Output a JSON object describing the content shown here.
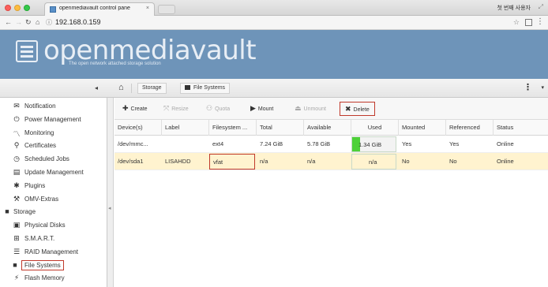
{
  "browser": {
    "tab_title": "openmediavault control pane",
    "tab_close": "×",
    "profile_label": "첫 번째 사용자",
    "url": "192.168.0.159"
  },
  "banner": {
    "logo_text": "openmediavault",
    "tagline": "The open network attached storage solution"
  },
  "toolbar": {
    "breadcrumbs": [
      "Storage",
      "File Systems"
    ],
    "menu_glyph": "⋮"
  },
  "sidebar": {
    "items": [
      {
        "label": "Notification",
        "icon": "mail-icon",
        "glyph": "✉"
      },
      {
        "label": "Power Management",
        "icon": "power-icon",
        "glyph": "⏻"
      },
      {
        "label": "Monitoring",
        "icon": "chart-icon",
        "glyph": "〽"
      },
      {
        "label": "Certificates",
        "icon": "certificate-icon",
        "glyph": "⚲"
      },
      {
        "label": "Scheduled Jobs",
        "icon": "clock-icon",
        "glyph": "◷"
      },
      {
        "label": "Update Management",
        "icon": "trash-icon",
        "glyph": "▤"
      },
      {
        "label": "Plugins",
        "icon": "puzzle-icon",
        "glyph": "✱"
      },
      {
        "label": "OMV-Extras",
        "icon": "wrench-icon",
        "glyph": "⚒"
      },
      {
        "label": "Storage",
        "icon": "storage-icon",
        "glyph": "■",
        "group": true
      },
      {
        "label": "Physical Disks",
        "icon": "disk-icon",
        "glyph": "▣"
      },
      {
        "label": "S.M.A.R.T.",
        "icon": "smart-icon",
        "glyph": "⊞"
      },
      {
        "label": "RAID Management",
        "icon": "raid-icon",
        "glyph": "☰"
      },
      {
        "label": "File Systems",
        "icon": "folder-icon",
        "glyph": "■",
        "selected": true
      },
      {
        "label": "Flash Memory",
        "icon": "flash-icon",
        "glyph": "⚡"
      }
    ]
  },
  "actions": {
    "create": "Create",
    "resize": "Resize",
    "quota": "Quota",
    "mount": "Mount",
    "unmount": "Unmount",
    "delete": "Delete"
  },
  "grid": {
    "columns": [
      "Device(s)",
      "Label",
      "Filesystem ...",
      "Total",
      "Available",
      "Used",
      "Mounted",
      "Referenced",
      "Status"
    ],
    "rows": [
      {
        "device": "/dev/mmc...",
        "label": "",
        "fs": "ext4",
        "total": "7.24 GiB",
        "available": "5.78 GiB",
        "used": "1.34 GiB",
        "used_fraction": 0.19,
        "mounted": "Yes",
        "referenced": "Yes",
        "status": "Online"
      },
      {
        "device": "/dev/sda1",
        "label": "LISAHDD",
        "fs": "vfat",
        "total": "n/a",
        "available": "n/a",
        "used": "n/a",
        "mounted": "No",
        "referenced": "No",
        "status": "Online"
      }
    ]
  },
  "colors": {
    "banner": "#6e94b9",
    "used_bar": "#4cd137",
    "highlight_box": "#c0392b",
    "selected_row": "#fff3cf"
  }
}
